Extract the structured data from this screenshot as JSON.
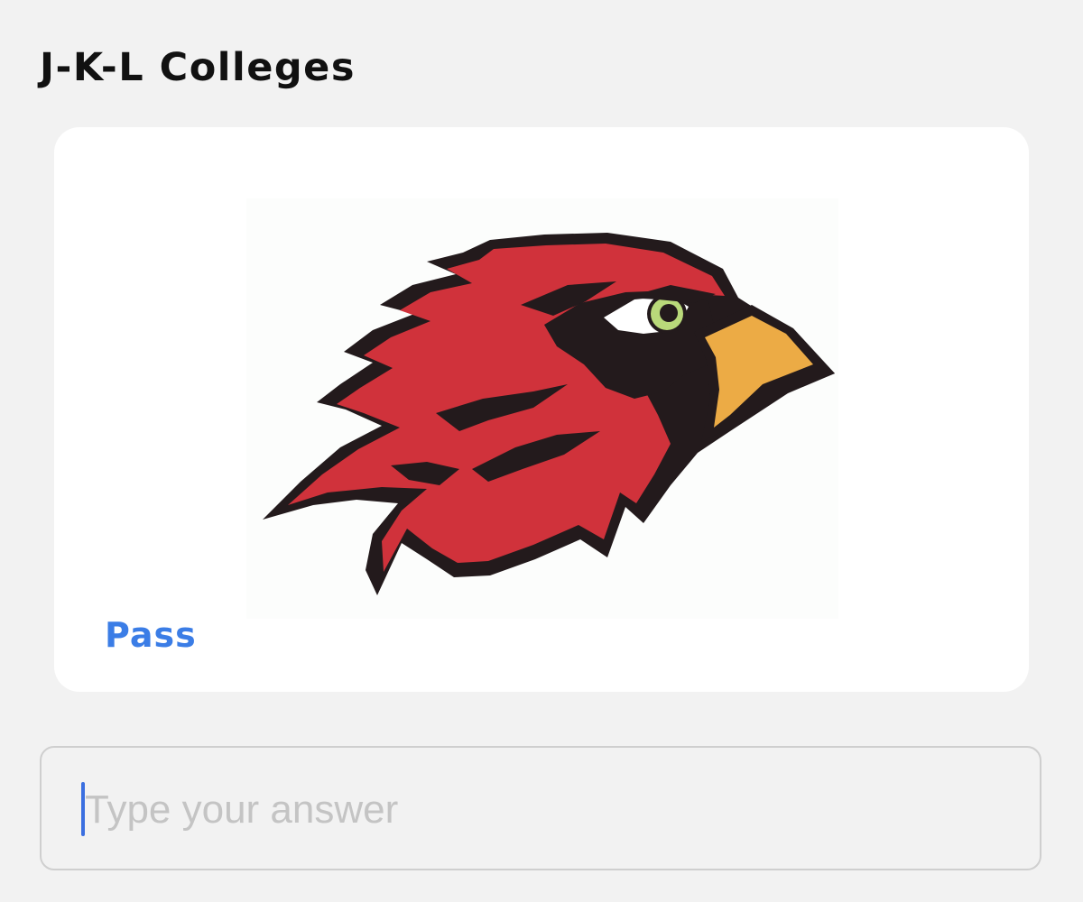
{
  "header": {
    "title": "J-K-L Colleges"
  },
  "card": {
    "image": {
      "icon": "cardinal-mascot-logo",
      "colors": {
        "body": "#d0323b",
        "outline": "#231a1c",
        "beak": "#ecab45",
        "eye": "#b9d97a"
      }
    },
    "pass_label": "Pass"
  },
  "answer": {
    "placeholder": "Type your answer",
    "value": ""
  },
  "colors": {
    "background": "#f2f2f2",
    "card": "#ffffff",
    "accent": "#3b7de6"
  }
}
